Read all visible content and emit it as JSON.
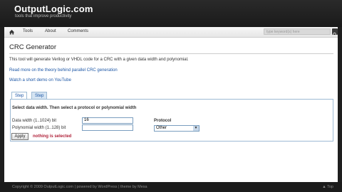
{
  "site": {
    "logo_title": "OutputLogic.com",
    "logo_subtitle": "tools that improve productivity"
  },
  "nav": {
    "items": [
      {
        "label": "Tools"
      },
      {
        "label": "About"
      },
      {
        "label": "Comments"
      }
    ],
    "search_placeholder": "type keyword(s) here"
  },
  "page": {
    "title": "CRC Generator",
    "intro": "This tool will generate Verilog or VHDL code for a CRC with a given data width and polynomial.",
    "theory_link": "Read more on the theory behind parallel CRC generation",
    "demo_link": "Watch a short demo on YouTube"
  },
  "form": {
    "tabs": [
      {
        "label": "Step 1",
        "active": true
      },
      {
        "label": "Step 2",
        "active": false
      }
    ],
    "instruction": "Select data width. Then select a protocol or polynomial width",
    "data_width_label": "Data width (1..1024) bit",
    "data_width_value": "16",
    "poly_width_label": "Polynomial width (1..128) bit",
    "poly_width_value": "",
    "protocol_label": "Protocol",
    "protocol_value": "Other",
    "apply_label": "Apply",
    "error_text": "nothing is selected"
  },
  "footer": {
    "copyright": "Copyright © 2009 OutputLogic.com | powered by WordPress | theme by Mesa",
    "top_link": "▲ Top"
  },
  "colors": {
    "frame": "#1e1e1e",
    "link": "#1d57a6",
    "error": "#b0223a",
    "tab_border": "#9dbad4"
  }
}
